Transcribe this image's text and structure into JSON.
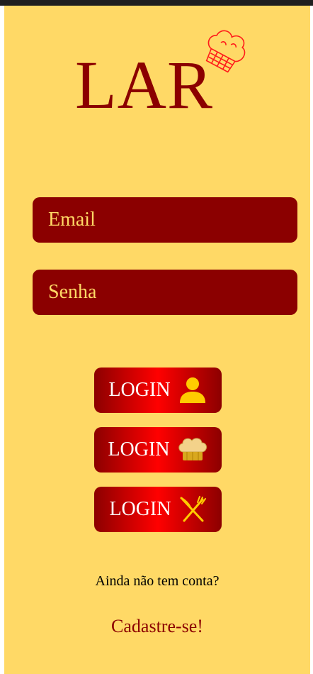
{
  "logo": {
    "text": "LAR"
  },
  "form": {
    "email_placeholder": "Email",
    "password_placeholder": "Senha"
  },
  "buttons": [
    {
      "label": "LOGIN",
      "icon": "user-icon"
    },
    {
      "label": "LOGIN",
      "icon": "chef-hat-icon"
    },
    {
      "label": "LOGIN",
      "icon": "fork-knife-icon"
    }
  ],
  "signup": {
    "prompt": "Ainda não tem conta?",
    "link": "Cadastre-se!"
  },
  "colors": {
    "background": "#ffd966",
    "accent": "#8b0000",
    "button_red": "#ff0000",
    "icon_gold": "#ffcc00"
  }
}
